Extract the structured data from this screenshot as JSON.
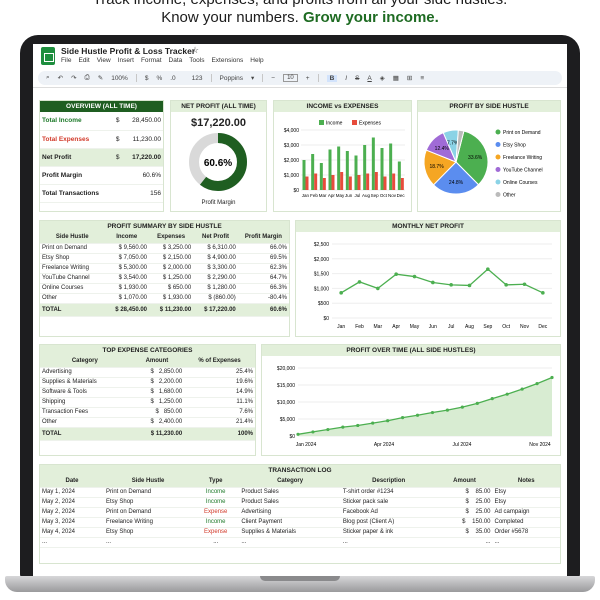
{
  "hero": {
    "line1": "Track income, expenses, and profits from all your side hustles.",
    "line2_plain": "Know your numbers.",
    "line2_bold": "Grow your income."
  },
  "sheet": {
    "title": "Side Hustle Profit & Loss Tracker",
    "menu": [
      "File",
      "Edit",
      "View",
      "Insert",
      "Format",
      "Data",
      "Tools",
      "Extensions",
      "Help"
    ],
    "toolbar": {
      "zoom": "100%",
      "currency": "$",
      "percent": "%",
      "decimals": ".0",
      ".00": ".00",
      "numfmt": "123",
      "font": "Poppins",
      "size": "10",
      "bold": "B",
      "italic": "I",
      "strike": "S",
      "underline": "A"
    }
  },
  "colors": {
    "accent": "#1f5e21",
    "panel_header": "#e2efda",
    "income": "#4caf50",
    "expense": "#e74c3c"
  },
  "overview": {
    "title": "OVERVIEW (ALL TIME)",
    "rows": [
      {
        "label": "Total Income",
        "cur": "$",
        "value": "28,450.00"
      },
      {
        "label": "Total Expenses",
        "cur": "$",
        "value": "11,230.00"
      },
      {
        "label": "Net Profit",
        "cur": "$",
        "value": "17,220.00"
      },
      {
        "label": "Profit Margin",
        "cur": "",
        "value": "60.6%"
      },
      {
        "label": "Total Transactions",
        "cur": "",
        "value": "156"
      }
    ]
  },
  "net_profit": {
    "title": "NET PROFIT (ALL TIME)",
    "value": "$17,220.00",
    "donut_center": "60.6%",
    "donut_fraction": 0.606,
    "caption": "Profit Margin"
  },
  "income_vs_expenses": {
    "title": "INCOME vs EXPENSES",
    "chart_data": {
      "type": "bar",
      "categories": [
        "Jan",
        "Feb",
        "Mar",
        "Apr",
        "May",
        "Jun",
        "Jul",
        "Aug",
        "Sep",
        "Oct",
        "Nov",
        "Dec"
      ],
      "series": [
        {
          "name": "Income",
          "values": [
            2000,
            2400,
            1800,
            2700,
            2900,
            2600,
            2300,
            3000,
            3500,
            2800,
            3100,
            1900
          ]
        },
        {
          "name": "Expense",
          "values": [
            900,
            1100,
            800,
            1000,
            1200,
            900,
            1000,
            1100,
            1200,
            900,
            1100,
            800
          ]
        }
      ],
      "yticks": [
        "$4,000",
        "$3,000",
        "$2,000",
        "$1,000",
        "$0"
      ],
      "ylim": [
        0,
        4000
      ]
    }
  },
  "by_hustle_pie": {
    "title": "PROFIT BY SIDE HUSTLE",
    "chart_data": {
      "type": "pie",
      "labels": [
        "Print on Demand",
        "Etsy Shop",
        "Freelance Writing",
        "YouTube Channel",
        "Online Courses",
        "Other"
      ],
      "values": [
        33.6,
        24.8,
        18.7,
        12.4,
        7.7,
        2.8
      ],
      "slice_labels": [
        "33.6%",
        "24.8%",
        "18.7%",
        "12.4%",
        "7.7%",
        ""
      ],
      "colors": [
        "#4caf50",
        "#5b8def",
        "#f5a623",
        "#a06bd6",
        "#8bd3e6",
        "#bbbbbb"
      ]
    }
  },
  "summary": {
    "title": "PROFIT SUMMARY BY SIDE HUSTLE",
    "headers": [
      "Side Hustle",
      "Income",
      "Expenses",
      "Net Profit",
      "Profit Margin"
    ],
    "rows": [
      [
        "Print on Demand",
        "9,560.00",
        "3,250.00",
        "6,310.00",
        "66.0%"
      ],
      [
        "Etsy Shop",
        "7,050.00",
        "2,150.00",
        "4,900.00",
        "69.5%"
      ],
      [
        "Freelance Writing",
        "5,300.00",
        "2,000.00",
        "3,300.00",
        "62.3%"
      ],
      [
        "YouTube Channel",
        "3,540.00",
        "1,250.00",
        "2,290.00",
        "64.7%"
      ],
      [
        "Online Courses",
        "1,930.00",
        "650.00",
        "1,280.00",
        "66.3%"
      ],
      [
        "Other",
        "1,070.00",
        "1,930.00",
        "(860.00)",
        "-80.4%"
      ]
    ],
    "total": [
      "TOTAL",
      "28,450.00",
      "11,230.00",
      "17,220.00",
      "60.6%"
    ]
  },
  "monthly_net": {
    "title": "MONTHLY NET PROFIT",
    "chart_data": {
      "type": "line",
      "x": [
        "Jan",
        "Feb",
        "Mar",
        "Apr",
        "May",
        "Jun",
        "Jul",
        "Aug",
        "Sep",
        "Oct",
        "Nov",
        "Dec"
      ],
      "values": [
        850,
        1220,
        1000,
        1480,
        1400,
        1200,
        1120,
        1100,
        1650,
        1120,
        1140,
        850
      ],
      "yticks": [
        "$2,500",
        "$2,000",
        "$1,500",
        "$1,000",
        "$500",
        "$0"
      ],
      "ylim": [
        0,
        2500
      ]
    }
  },
  "expense_categories": {
    "title": "TOP EXPENSE CATEGORIES",
    "headers": [
      "Category",
      "Amount",
      "% of Expenses"
    ],
    "rows": [
      [
        "Advertising",
        "2,850.00",
        "25.4%"
      ],
      [
        "Supplies & Materials",
        "2,200.00",
        "19.6%"
      ],
      [
        "Software & Tools",
        "1,680.00",
        "14.9%"
      ],
      [
        "Shipping",
        "1,250.00",
        "11.1%"
      ],
      [
        "Transaction Fees",
        "850.00",
        "7.6%"
      ],
      [
        "Other",
        "2,400.00",
        "21.4%"
      ]
    ],
    "total": [
      "TOTAL",
      "11,230.00",
      "100%"
    ]
  },
  "profit_over_time": {
    "title": "PROFIT OVER TIME (ALL SIDE HUSTLES)",
    "chart_data": {
      "type": "area",
      "x_labels": [
        "Jan 2024",
        "Apr 2024",
        "Jul 2024",
        "Nov 2024"
      ],
      "values": [
        500,
        1200,
        1900,
        2600,
        3100,
        3800,
        4500,
        5400,
        6100,
        6900,
        7600,
        8500,
        9600,
        11000,
        12300,
        13800,
        15400,
        17200
      ],
      "yticks": [
        "$20,000",
        "$15,000",
        "$10,000",
        "$5,000",
        "$0"
      ],
      "ylim": [
        0,
        20000
      ]
    }
  },
  "transactions": {
    "title": "TRANSACTION LOG",
    "headers": [
      "Date",
      "Side Hustle",
      "Type",
      "Category",
      "Description",
      "Amount",
      "Notes"
    ],
    "rows": [
      [
        "May 1, 2024",
        "Print on Demand",
        "Income",
        "Product Sales",
        "T-shirt order #1234",
        "85.00",
        "Etsy"
      ],
      [
        "May 2, 2024",
        "Etsy Shop",
        "Income",
        "Product Sales",
        "Sticker pack sale",
        "25.00",
        "Etsy"
      ],
      [
        "May 2, 2024",
        "Print on Demand",
        "Expense",
        "Advertising",
        "Facebook Ad",
        "25.00",
        "Ad campaign"
      ],
      [
        "May 3, 2024",
        "Freelance Writing",
        "Income",
        "Client Payment",
        "Blog post (Client A)",
        "150.00",
        "Completed"
      ],
      [
        "May 4, 2024",
        "Etsy Shop",
        "Expense",
        "Supplies & Materials",
        "Sticker paper & ink",
        "35.00",
        "Order #5678"
      ],
      [
        "...",
        "...",
        "...",
        "...",
        "...",
        "...",
        "..."
      ]
    ]
  }
}
